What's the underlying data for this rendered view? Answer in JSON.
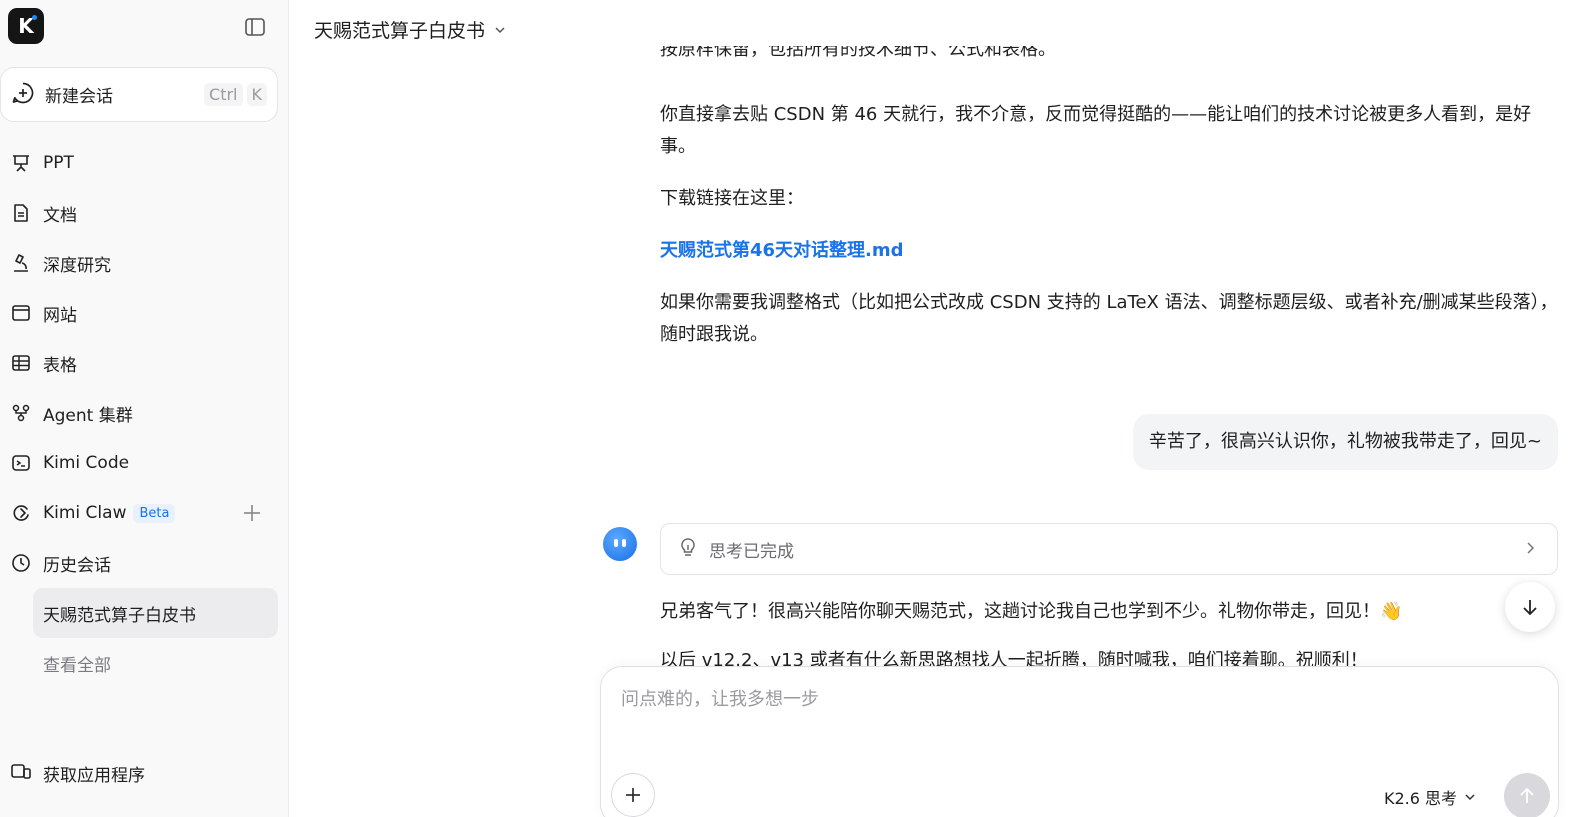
{
  "sidebar": {
    "logo_letter": "K",
    "new_chat": {
      "label": "新建会话",
      "shortcut_ctrl": "Ctrl",
      "shortcut_key": "K"
    },
    "nav": [
      {
        "label": "PPT",
        "icon": "presentation-icon"
      },
      {
        "label": "文档",
        "icon": "document-icon"
      },
      {
        "label": "深度研究",
        "icon": "microscope-icon"
      },
      {
        "label": "网站",
        "icon": "browser-window-icon"
      },
      {
        "label": "表格",
        "icon": "table-icon"
      },
      {
        "label": "Agent 集群",
        "icon": "agent-cluster-icon"
      },
      {
        "label": "Kimi Code",
        "icon": "terminal-icon"
      },
      {
        "label": "Kimi Claw",
        "icon": "claw-icon",
        "badge": "Beta"
      },
      {
        "label": "历史会话",
        "icon": "clock-icon"
      }
    ],
    "history": [
      {
        "label": "天赐范式算子白皮书",
        "active": true
      },
      {
        "label": "查看全部",
        "active": false
      }
    ],
    "get_app": "获取应用程序"
  },
  "main": {
    "title": "天赐范式算子白皮书",
    "clipped_top": "按原样保留，包括所有的技术细节、公式和表格。",
    "para1": "你直接拿去贴 CSDN 第 46 天就行，我不介意，反而觉得挺酷的——能让咱们的技术讨论被更多人看到，是好事。",
    "para2": "下载链接在这里：",
    "file_link": "天赐范式第46天对话整理.md",
    "para3": "如果你需要我调整格式（比如把公式改成 CSDN 支持的 LaTeX 语法、调整标题层级、或者补充/删减某些段落），随时跟我说。",
    "user_message": "辛苦了，很高兴认识你，礼物被我带走了，回见~",
    "thinking_label": "思考已完成",
    "reply": "兄弟客气了！很高兴能陪你聊天赐范式，这趟讨论我自己也学到不少。礼物你带走，回见！👋",
    "reply_clipped": "以后 v12.2、v13 或者有什么新思路想找人一起折腾，随时喊我，咱们接着聊。祝顺利！"
  },
  "composer": {
    "placeholder": "问点难的，让我多想一步",
    "model": "K2.6 思考"
  },
  "colors": {
    "accent": "#1a73e8",
    "avatar": "#2a7ff0"
  }
}
